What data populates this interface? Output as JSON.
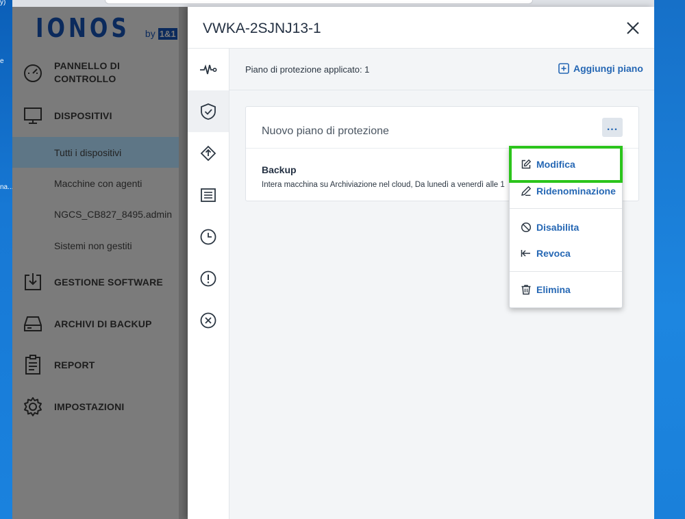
{
  "desktop": {
    "side_labels": [
      "y)",
      "e",
      "na..."
    ]
  },
  "sidebar": {
    "logo": {
      "text": "IONOS",
      "by": "by",
      "badge": "1&1"
    },
    "items": [
      {
        "label_line1": "PANNELLO DI",
        "label_line2": "CONTROLLO",
        "icon": "dashboard-gauge-icon"
      },
      {
        "label": "DISPOSITIVI",
        "icon": "monitor-icon"
      },
      {
        "label": "GESTIONE SOFTWARE",
        "icon": "software-download-icon"
      },
      {
        "label": "ARCHIVI DI BACKUP",
        "icon": "storage-drive-icon"
      },
      {
        "label": "REPORT",
        "icon": "report-clipboard-icon"
      },
      {
        "label": "IMPOSTAZIONI",
        "icon": "gear-icon"
      }
    ],
    "sub_items": [
      "Tutti i dispositivi",
      "Macchine con agenti",
      "NGCS_CB827_8495.admin",
      "Sistemi non gestiti"
    ]
  },
  "panel": {
    "title": "VWKA-2SJNJ13-1",
    "tabs": [
      "activity-icon",
      "shield-check-icon",
      "recovery-icon",
      "list-icon",
      "clock-icon",
      "alert-icon",
      "cancel-icon"
    ],
    "applied_text": "Piano di protezione applicato: 1",
    "add_plan_label": "Aggiungi piano",
    "plan": {
      "name": "Nuovo piano di protezione",
      "more_label": "...",
      "section": "Backup",
      "description": "Intera macchina su Archiviazione nel cloud, Da lunedì a venerdì alle 1"
    }
  },
  "menu": {
    "items": [
      {
        "label": "Modifica",
        "icon": "edit-icon"
      },
      {
        "label": "Ridenominazione",
        "icon": "pencil-icon"
      },
      {
        "label": "Disabilita",
        "icon": "disable-icon"
      },
      {
        "label": "Revoca",
        "icon": "revoke-arrow-icon"
      },
      {
        "label": "Elimina",
        "icon": "trash-icon"
      }
    ]
  },
  "colors": {
    "accent": "#2567b4",
    "highlight": "#2bc41b",
    "sidebar_dim": "#7b7b7b",
    "active_sub": "#5e7686"
  }
}
